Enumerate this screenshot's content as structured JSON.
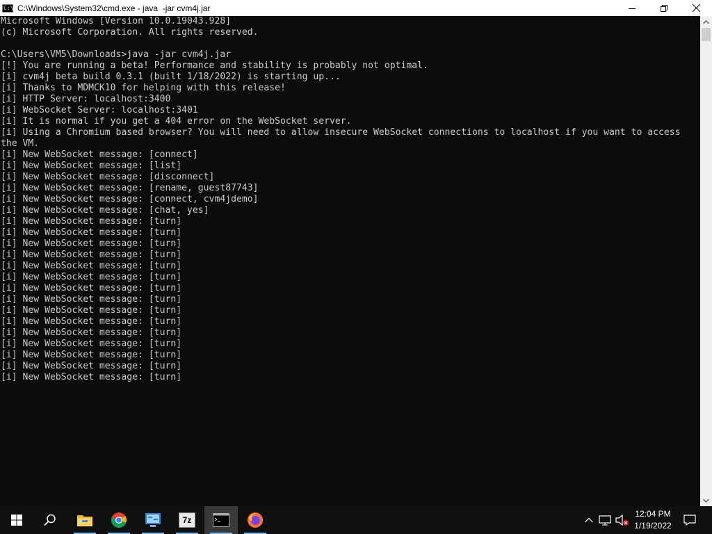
{
  "window": {
    "title": "C:\\Windows\\System32\\cmd.exe - java  -jar cvm4j.jar",
    "app_icon_text": "C:\\"
  },
  "console": {
    "lines": [
      "Microsoft Windows [Version 10.0.19043.928]",
      "(c) Microsoft Corporation. All rights reserved.",
      "",
      "C:\\Users\\VM5\\Downloads>java -jar cvm4j.jar",
      "[!] You are running a beta! Performance and stability is probably not optimal.",
      "[i] cvm4j beta build 0.3.1 (built 1/18/2022) is starting up...",
      "[i] Thanks to MDMCK10 for helping with this release!",
      "[i] HTTP Server: localhost:3400",
      "[i] WebSocket Server: localhost:3401",
      "[i] It is normal if you get a 404 error on the WebSocket server.",
      "[i] Using a Chromium based browser? You will need to allow insecure WebSocket connections to localhost if you want to access",
      "the VM.",
      "[i] New WebSocket message: [connect]",
      "[i] New WebSocket message: [list]",
      "[i] New WebSocket message: [disconnect]",
      "[i] New WebSocket message: [rename, guest87743]",
      "[i] New WebSocket message: [connect, cvm4jdemo]",
      "[i] New WebSocket message: [chat, yes]",
      "[i] New WebSocket message: [turn]",
      "[i] New WebSocket message: [turn]",
      "[i] New WebSocket message: [turn]",
      "[i] New WebSocket message: [turn]",
      "[i] New WebSocket message: [turn]",
      "[i] New WebSocket message: [turn]",
      "[i] New WebSocket message: [turn]",
      "[i] New WebSocket message: [turn]",
      "[i] New WebSocket message: [turn]",
      "[i] New WebSocket message: [turn]",
      "[i] New WebSocket message: [turn]",
      "[i] New WebSocket message: [turn]",
      "[i] New WebSocket message: [turn]",
      "[i] New WebSocket message: [turn]",
      "[i] New WebSocket message: [turn]"
    ]
  },
  "taskbar": {
    "pinned": [
      {
        "name": "start-button",
        "icon": "windows-logo-icon"
      },
      {
        "name": "search-button",
        "icon": "search-icon"
      },
      {
        "name": "file-explorer-button",
        "icon": "folder-icon"
      },
      {
        "name": "chrome-button",
        "icon": "chrome-icon"
      },
      {
        "name": "control-panel-button",
        "icon": "control-panel-icon"
      },
      {
        "name": "7zip-button",
        "icon": "7zip-icon",
        "label": "7z"
      },
      {
        "name": "cmd-button",
        "icon": "cmd-icon"
      },
      {
        "name": "firefox-button",
        "icon": "firefox-icon"
      }
    ],
    "tray": {
      "time": "12:04 PM",
      "date": "1/19/2022"
    }
  },
  "colors": {
    "console_bg": "#0c0c0c",
    "console_text": "#cccccc",
    "taskbar_bg": "#101010",
    "accent": "#76b9ed"
  }
}
